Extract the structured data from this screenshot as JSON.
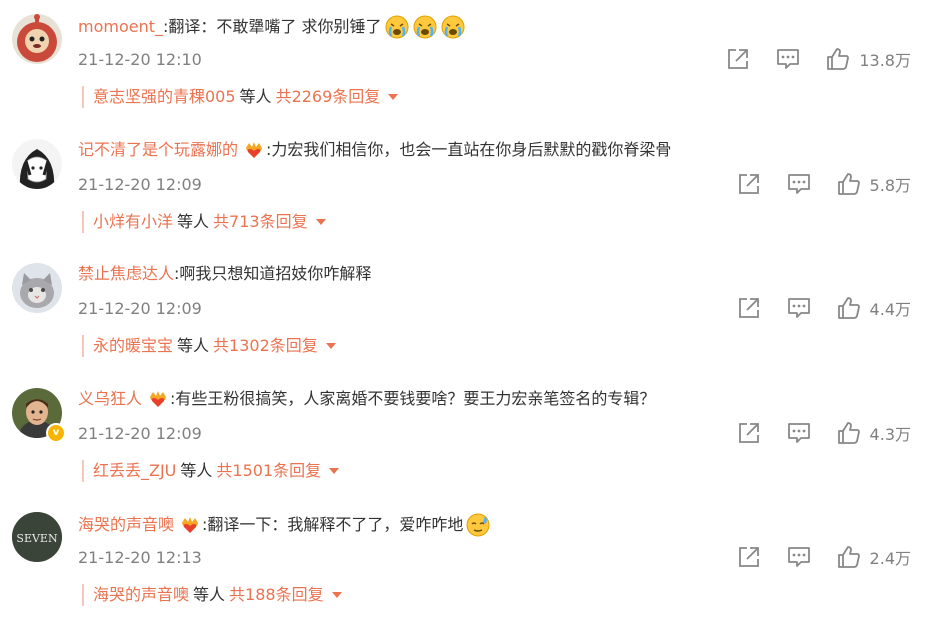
{
  "colors": {
    "username": "#eb7350",
    "text": "#333333",
    "meta": "#808080"
  },
  "icons": {
    "share": "share-icon",
    "reply": "comment-icon",
    "like": "thumbs-up-icon",
    "crown": "crown-heart-icon"
  },
  "comments": [
    {
      "username": "momoent_",
      "colon": ":",
      "text": "翻译：不敢犟嘴了 求你别锤了",
      "emoji": "crying-face-icon x3",
      "time": "21-12-20 12:10",
      "likes": "13.8万",
      "reply_user": "意志坚强的青稞005",
      "reply_mid": "等人",
      "reply_total": "共2269条回复"
    },
    {
      "username": "记不清了是个玩露娜的",
      "colon": ":",
      "text": "力宏我们相信你，也会一直站在你身后默默的戳你脊梁骨",
      "time": "21-12-20 12:09",
      "likes": "5.8万",
      "reply_user": "小烊有小洋",
      "reply_mid": "等人",
      "reply_total": "共713条回复"
    },
    {
      "username": "禁止焦虑达人",
      "colon": ":",
      "text": "啊我只想知道招妓你咋解释",
      "time": "21-12-20 12:09",
      "likes": "4.4万",
      "reply_user": "永的暖宝宝",
      "reply_mid": "等人",
      "reply_total": "共1302条回复"
    },
    {
      "username": "义乌狂人",
      "colon": ":",
      "text": "有些王粉很搞笑，人家离婚不要钱要啥？要王力宏亲笔签名的专辑？",
      "time": "21-12-20 12:09",
      "likes": "4.3万",
      "reply_user": "红丢丢_ZJU",
      "reply_mid": "等人",
      "reply_total": "共1501条回复"
    },
    {
      "username": "海哭的声音噢",
      "colon": ":",
      "text": "翻译一下：我解释不了了，爱咋咋地",
      "time": "21-12-20 12:13",
      "likes": "2.4万",
      "reply_user": "海哭的声音噢",
      "reply_mid": "等人",
      "reply_total": "共188条回复"
    }
  ]
}
